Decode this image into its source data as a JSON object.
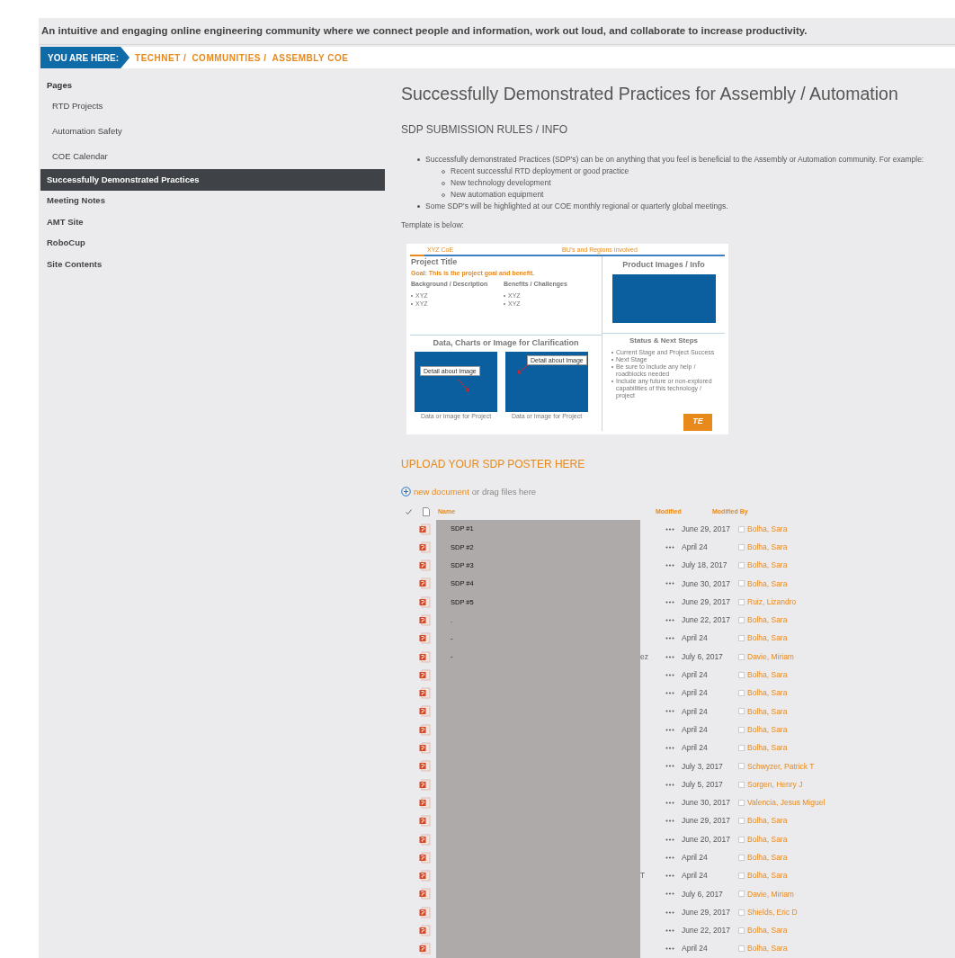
{
  "tagline": "An intuitive and engaging online engineering community where we connect people and information, work out loud, and collaborate to increase productivity.",
  "breadcrumb": {
    "label": "YOU ARE HERE:",
    "items": [
      "TECHNET /",
      "COMMUNITIES /",
      "ASSEMBLY COE"
    ]
  },
  "sidebar": {
    "heading": "Pages",
    "items": [
      {
        "label": "RTD Projects",
        "kind": "sub",
        "selected": false
      },
      {
        "label": "Automation Safety",
        "kind": "sub",
        "selected": false
      },
      {
        "label": "COE Calendar",
        "kind": "sub",
        "selected": false
      },
      {
        "label": "Successfully Demonstrated Practices",
        "kind": "top",
        "selected": true
      },
      {
        "label": "Meeting Notes",
        "kind": "top",
        "selected": false
      },
      {
        "label": "AMT Site",
        "kind": "top",
        "selected": false
      },
      {
        "label": "RoboCup",
        "kind": "top",
        "selected": false
      },
      {
        "label": "Site Contents",
        "kind": "top",
        "selected": false
      }
    ]
  },
  "main": {
    "title": "Successfully Demonstrated Practices for Assembly / Automation",
    "subheading": "SDP SUBMISSION RULES / INFO",
    "bullets": [
      {
        "text": "Successfully demonstrated Practices (SDP's) can be on anything that you feel is beneficial to the Assembly or Automation community. For example:",
        "children": [
          {
            "text": "Recent successful RTD deployment or good practice"
          },
          {
            "text": "New technology development"
          },
          {
            "text": "New automation equipment"
          }
        ]
      },
      {
        "text": "Some SDP's will be highlighted at our COE monthly regional or quarterly global meetings."
      }
    ],
    "template_label": "Template is below:",
    "template": {
      "header_left": "XYZ CoE",
      "header_right": "BU's and Regions Involved",
      "project_title": "Project Title",
      "goal": "Goal: This is the project goal and benefit.",
      "columns": [
        {
          "heading": "Background / Description",
          "items": [
            "XYZ",
            "XYZ"
          ]
        },
        {
          "heading": "Benefits / Challenges",
          "items": [
            "XYZ",
            "XYZ"
          ]
        }
      ],
      "data_heading": "Data, Charts or Image for Clarification",
      "panels": [
        {
          "callout": "Detail about Image",
          "caption": "Data or Image for Project"
        },
        {
          "callout": "Detail about Image",
          "caption": "Data or Image for Project"
        }
      ],
      "product_heading": "Product Images / Info",
      "status_heading": "Status & Next Steps",
      "status_items": [
        "Current Stage and Project Success",
        "Next Stage",
        "Be sure to include any help / roadblocks needed",
        "Include any future or non-explored capabilities of this technology / project"
      ],
      "logo": "TE"
    },
    "upload_heading": "UPLOAD YOUR SDP POSTER HERE",
    "new_document": {
      "link": "new document",
      "rest": "or drag files here"
    },
    "table": {
      "columns": [
        "Name",
        "Modified",
        "Modified By"
      ],
      "rows": [
        {
          "name": "SDP #1",
          "modified": "June 29, 2017",
          "modified_by": "Bolha, Sara"
        },
        {
          "name": "SDP #2",
          "modified": "April 24",
          "modified_by": "Bolha, Sara"
        },
        {
          "name": "SDP #3",
          "modified": "July 18, 2017",
          "modified_by": "Bolha, Sara"
        },
        {
          "name": "SDP #4",
          "modified": "June 30, 2017",
          "modified_by": "Bolha, Sara"
        },
        {
          "name": "SDP #5",
          "modified": "June 29, 2017",
          "modified_by": "Ruiz, Lizandro"
        },
        {
          "name": ".",
          "modified": "June 22, 2017",
          "modified_by": "Bolha, Sara"
        },
        {
          "name": "-",
          "modified": "April 24",
          "modified_by": "Bolha, Sara"
        },
        {
          "name": "-",
          "name_tail": "ez",
          "modified": "July 6, 2017",
          "modified_by": "Davie, Miriam"
        },
        {
          "modified": "April 24",
          "modified_by": "Bolha, Sara"
        },
        {
          "modified": "April 24",
          "modified_by": "Bolha, Sara"
        },
        {
          "modified": "April 24",
          "modified_by": "Bolha, Sara"
        },
        {
          "modified": "April 24",
          "modified_by": "Bolha, Sara"
        },
        {
          "modified": "April 24",
          "modified_by": "Bolha, Sara"
        },
        {
          "modified": "July 3, 2017",
          "modified_by": "Schwyzer, Patrick T"
        },
        {
          "modified": "July 5, 2017",
          "modified_by": "Sorgen, Henry J"
        },
        {
          "modified": "June 30, 2017",
          "modified_by": "Valencia, Jesus Miguel"
        },
        {
          "modified": "June 29, 2017",
          "modified_by": "Bolha, Sara"
        },
        {
          "modified": "June 20, 2017",
          "modified_by": "Bolha, Sara"
        },
        {
          "modified": "April 24",
          "modified_by": "Bolha, Sara"
        },
        {
          "name_tail": "T",
          "modified": "April 24",
          "modified_by": "Bolha, Sara"
        },
        {
          "modified": "July 6, 2017",
          "modified_by": "Davie, Miriam"
        },
        {
          "modified": "June 29, 2017",
          "modified_by": "Shields, Eric D"
        },
        {
          "modified": "June 22, 2017",
          "modified_by": "Bolha, Sara"
        },
        {
          "modified": "April 24",
          "modified_by": "Bolha, Sara"
        }
      ]
    }
  }
}
